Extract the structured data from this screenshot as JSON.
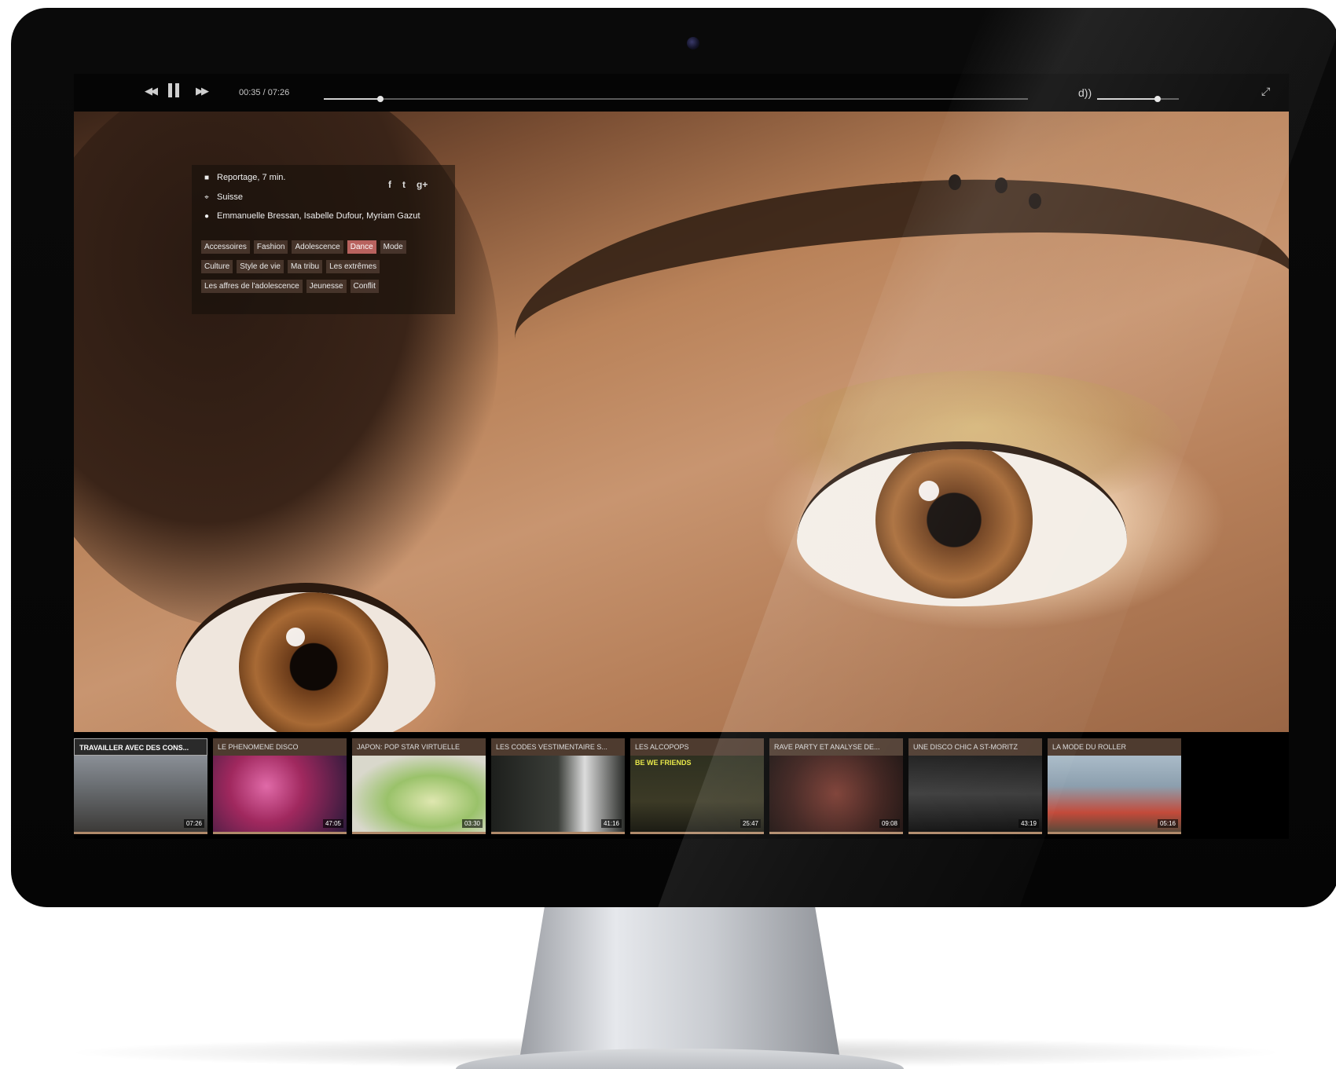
{
  "player": {
    "controls": {
      "rewind_icon": "rewind-icon",
      "pause_icon": "pause-icon",
      "forward_icon": "fast-forward-icon",
      "time": "00:35 / 07:26",
      "progress": 0.08,
      "volume_icon": "volume-icon",
      "volume_label": "d))",
      "volume": 0.74,
      "fullscreen_icon": "fullscreen-icon"
    },
    "info": {
      "type": "Reportage, 7 min.",
      "location": "Suisse",
      "authors": "Emmanuelle Bressan, Isabelle Dufour, Myriam Gazut",
      "share": {
        "facebook": "f",
        "twitter": "t",
        "google": "g+"
      },
      "tags": [
        [
          {
            "label": "Accessoires",
            "active": false
          },
          {
            "label": "Fashion",
            "active": false
          },
          {
            "label": "Adolescence",
            "active": false
          },
          {
            "label": "Dance",
            "active": true
          },
          {
            "label": "Mode",
            "active": false
          }
        ],
        [
          {
            "label": "Culture",
            "active": false
          },
          {
            "label": "Style de vie",
            "active": false
          },
          {
            "label": "Ma tribu",
            "active": false
          },
          {
            "label": "Les extrêmes",
            "active": false
          }
        ],
        [
          {
            "label": "Les affres de l'adolescence",
            "active": false
          },
          {
            "label": "Jeunesse",
            "active": false
          },
          {
            "label": "Conflit",
            "active": false
          }
        ]
      ]
    },
    "thumbnails": [
      {
        "title": "TRAVAILLER AVEC DES CONS...",
        "duration": "07:26",
        "active": true
      },
      {
        "title": "LE PHENOMENE DISCO",
        "duration": "47:05",
        "active": false
      },
      {
        "title": "JAPON: POP STAR VIRTUELLE",
        "duration": "03:30",
        "active": false
      },
      {
        "title": "LES CODES VESTIMENTAIRE S...",
        "duration": "41:16",
        "active": false
      },
      {
        "title": "LES ALCOPOPS",
        "duration": "25:47",
        "active": false
      },
      {
        "title": "RAVE PARTY ET ANALYSE DE...",
        "duration": "09:08",
        "active": false
      },
      {
        "title": "UNE DISCO CHIC A ST-MORITZ",
        "duration": "43:19",
        "active": false
      },
      {
        "title": "LA MODE DU ROLLER",
        "duration": "05:16",
        "active": false
      }
    ],
    "alcopops_overlay_text": "BE WE FRIENDS"
  }
}
